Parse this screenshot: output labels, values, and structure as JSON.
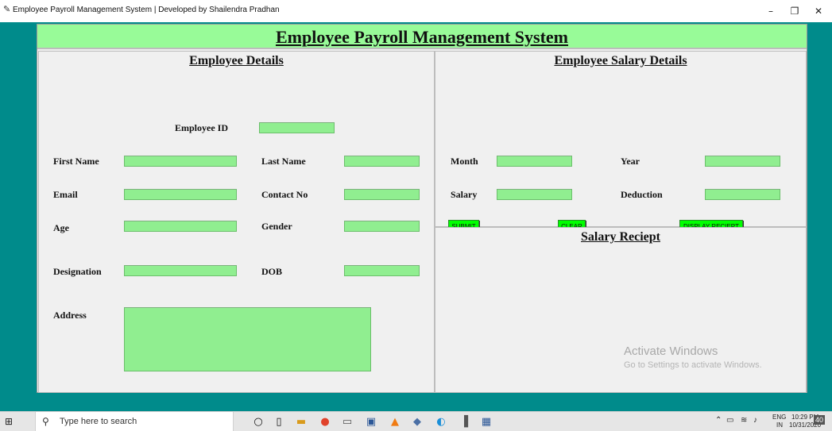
{
  "window": {
    "title": "Employee Payroll Management System | Developed by Shailendra Pradhan",
    "minimize": "–",
    "maximize": "❐",
    "close": "✕"
  },
  "header": {
    "title": "Employee Payroll Management System"
  },
  "employee_details": {
    "title": "Employee Details",
    "employee_id_label": "Employee ID",
    "first_name_label": "First Name",
    "last_name_label": "Last Name",
    "email_label": "Email",
    "contact_label": "Contact No",
    "age_label": "Age",
    "gender_label": "Gender",
    "designation_label": "Designation",
    "dob_label": "DOB",
    "address_label": "Address"
  },
  "salary_details": {
    "title": "Employee Salary Details",
    "month_label": "Month",
    "year_label": "Year",
    "salary_label": "Salary",
    "deduction_label": "Deduction",
    "submit_label": "SUBMIT",
    "clear_label": "CLEAR",
    "display_label": "DISPLAY RECIEPT"
  },
  "receipt": {
    "title": "Salary Reciept"
  },
  "watermark": {
    "line1": "Activate Windows",
    "line2": "Go to Settings to activate Windows."
  },
  "taskbar": {
    "search_placeholder": "Type here to search",
    "language": "ENG",
    "region": "IN",
    "time": "10:29 PM",
    "date": "10/31/2020",
    "notification_count": "40"
  },
  "colors": {
    "background": "#008b8b",
    "header_bg": "#98fb98",
    "field_bg": "#90ee90",
    "button_bg": "#00ff00",
    "panel_bg": "#f0f0f0"
  }
}
